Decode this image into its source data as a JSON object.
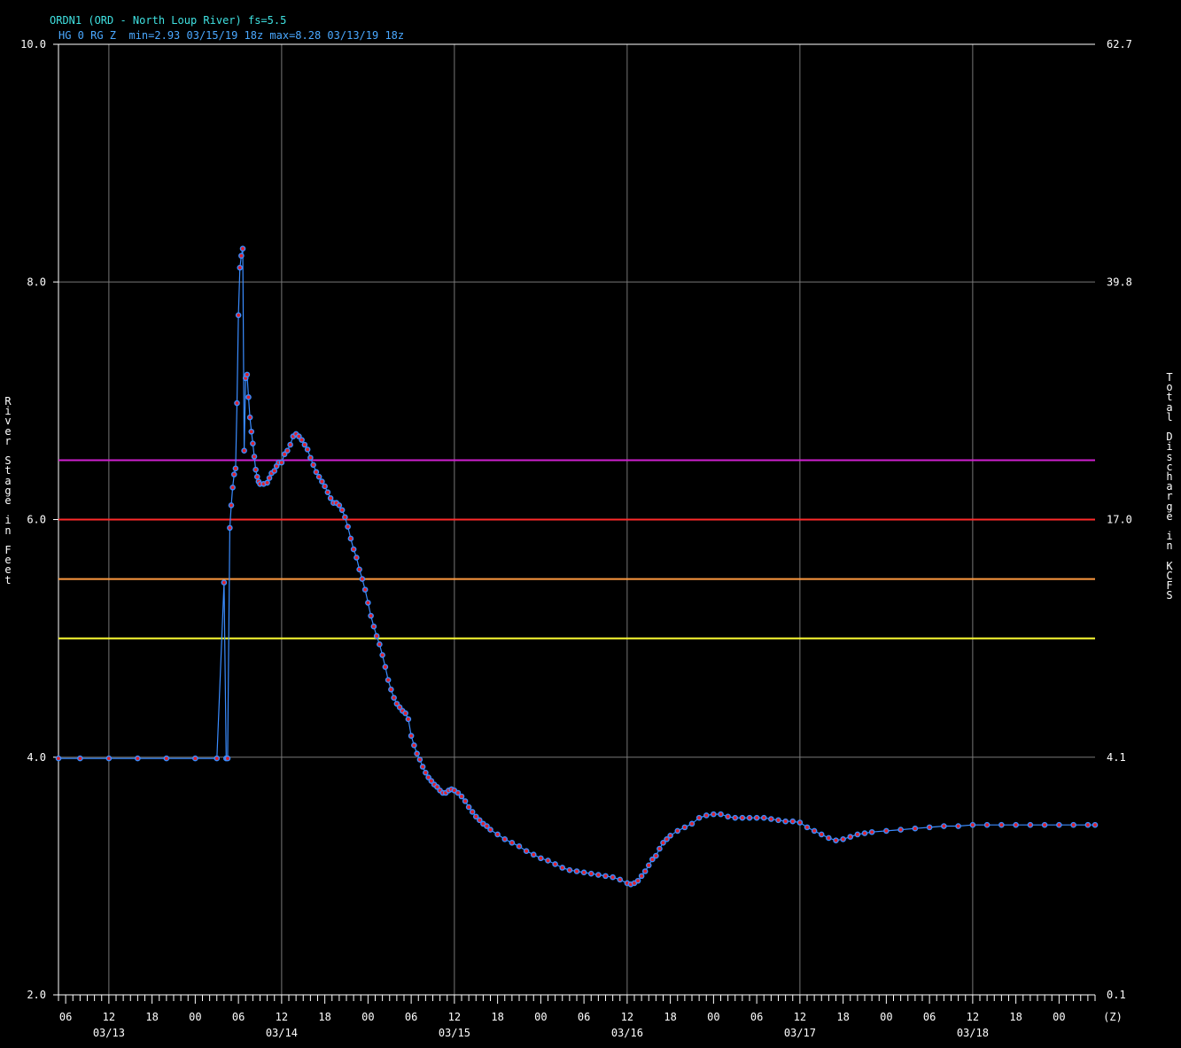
{
  "title_line1": "ORDN1 (ORD - North Loup River) fs=5.5",
  "title_line2": "HG 0 RG Z  min=2.93 03/15/19 18z max=8.28 03/13/19 18z",
  "chart_data": {
    "type": "line",
    "ylabel_left": "River Stage in Feet",
    "ylabel_right": "Total Discharge in KCFS",
    "ylim": [
      2.0,
      10.0
    ],
    "y_ticks_left": [
      "10.0",
      "8.0",
      "6.0",
      "4.0",
      "2.0"
    ],
    "y_ticks_right": [
      "62.7",
      "39.8",
      "17.0",
      "4.1",
      "0.1"
    ],
    "x_hour_ticks": [
      "06",
      "12",
      "18",
      "00",
      "06",
      "12",
      "18",
      "00",
      "06",
      "12",
      "18",
      "00",
      "06",
      "12",
      "18",
      "00",
      "06",
      "12",
      "18",
      "00",
      "06",
      "12",
      "18",
      "00"
    ],
    "x_date_ticks": [
      "03/13",
      "03/14",
      "03/15",
      "03/16",
      "03/17",
      "03/18"
    ],
    "x_unit_label": "(Z)",
    "x_range_hours_from_03_13_00z": [
      -7,
      137
    ],
    "threshold_lines": [
      {
        "stage": 6.5,
        "color": "#d020d0"
      },
      {
        "stage": 6.0,
        "color": "#ff2a2a"
      },
      {
        "stage": 5.5,
        "color": "#ff9a40"
      },
      {
        "stage": 5.0,
        "color": "#ffff33"
      }
    ],
    "series": [
      {
        "line_color": "#3a8cff",
        "marker_color": "#e0202a",
        "points": [
          [
            -7,
            3.99
          ],
          [
            -4,
            3.99
          ],
          [
            0,
            3.99
          ],
          [
            4,
            3.99
          ],
          [
            8,
            3.99
          ],
          [
            12,
            3.99
          ],
          [
            15,
            3.99
          ],
          [
            16,
            5.47
          ],
          [
            16.3,
            3.99
          ],
          [
            16.5,
            3.99
          ],
          [
            16.8,
            5.93
          ],
          [
            17,
            6.12
          ],
          [
            17.2,
            6.27
          ],
          [
            17.4,
            6.38
          ],
          [
            17.6,
            6.43
          ],
          [
            17.8,
            6.98
          ],
          [
            18,
            7.72
          ],
          [
            18.2,
            8.12
          ],
          [
            18.4,
            8.22
          ],
          [
            18.6,
            8.28
          ],
          [
            18.8,
            6.58
          ],
          [
            19,
            7.19
          ],
          [
            19.2,
            7.22
          ],
          [
            19.4,
            7.03
          ],
          [
            19.6,
            6.86
          ],
          [
            19.8,
            6.74
          ],
          [
            20,
            6.64
          ],
          [
            20.2,
            6.53
          ],
          [
            20.4,
            6.42
          ],
          [
            20.6,
            6.36
          ],
          [
            20.8,
            6.32
          ],
          [
            21,
            6.3
          ],
          [
            21.5,
            6.3
          ],
          [
            22,
            6.31
          ],
          [
            22.3,
            6.35
          ],
          [
            22.6,
            6.39
          ],
          [
            23,
            6.41
          ],
          [
            23.3,
            6.45
          ],
          [
            23.6,
            6.48
          ],
          [
            24,
            6.48
          ],
          [
            24.4,
            6.55
          ],
          [
            24.8,
            6.58
          ],
          [
            25.2,
            6.63
          ],
          [
            25.6,
            6.7
          ],
          [
            26,
            6.72
          ],
          [
            26.4,
            6.7
          ],
          [
            26.8,
            6.67
          ],
          [
            27.2,
            6.63
          ],
          [
            27.6,
            6.59
          ],
          [
            28,
            6.52
          ],
          [
            28.4,
            6.46
          ],
          [
            28.8,
            6.4
          ],
          [
            29.2,
            6.36
          ],
          [
            29.6,
            6.32
          ],
          [
            30,
            6.28
          ],
          [
            30.4,
            6.23
          ],
          [
            30.8,
            6.18
          ],
          [
            31.2,
            6.14
          ],
          [
            31.6,
            6.14
          ],
          [
            32,
            6.12
          ],
          [
            32.4,
            6.08
          ],
          [
            32.8,
            6.02
          ],
          [
            33.2,
            5.94
          ],
          [
            33.6,
            5.84
          ],
          [
            34,
            5.75
          ],
          [
            34.4,
            5.68
          ],
          [
            34.8,
            5.58
          ],
          [
            35.2,
            5.5
          ],
          [
            35.6,
            5.41
          ],
          [
            36,
            5.3
          ],
          [
            36.4,
            5.19
          ],
          [
            36.8,
            5.1
          ],
          [
            37.2,
            5.02
          ],
          [
            37.6,
            4.95
          ],
          [
            38,
            4.86
          ],
          [
            38.4,
            4.76
          ],
          [
            38.8,
            4.65
          ],
          [
            39.2,
            4.57
          ],
          [
            39.6,
            4.5
          ],
          [
            40,
            4.45
          ],
          [
            40.4,
            4.42
          ],
          [
            40.8,
            4.39
          ],
          [
            41.2,
            4.37
          ],
          [
            41.6,
            4.32
          ],
          [
            42,
            4.18
          ],
          [
            42.4,
            4.1
          ],
          [
            42.8,
            4.03
          ],
          [
            43.2,
            3.98
          ],
          [
            43.6,
            3.92
          ],
          [
            44,
            3.87
          ],
          [
            44.4,
            3.83
          ],
          [
            44.8,
            3.8
          ],
          [
            45.2,
            3.77
          ],
          [
            45.6,
            3.75
          ],
          [
            46,
            3.72
          ],
          [
            46.4,
            3.7
          ],
          [
            46.8,
            3.7
          ],
          [
            47.2,
            3.72
          ],
          [
            47.6,
            3.73
          ],
          [
            48,
            3.72
          ],
          [
            48.5,
            3.7
          ],
          [
            49,
            3.67
          ],
          [
            49.5,
            3.63
          ],
          [
            50,
            3.58
          ],
          [
            50.5,
            3.54
          ],
          [
            51,
            3.5
          ],
          [
            51.5,
            3.47
          ],
          [
            52,
            3.44
          ],
          [
            52.5,
            3.42
          ],
          [
            53,
            3.39
          ],
          [
            54,
            3.35
          ],
          [
            55,
            3.31
          ],
          [
            56,
            3.28
          ],
          [
            57,
            3.25
          ],
          [
            58,
            3.21
          ],
          [
            59,
            3.18
          ],
          [
            60,
            3.15
          ],
          [
            61,
            3.13
          ],
          [
            62,
            3.1
          ],
          [
            63,
            3.07
          ],
          [
            64,
            3.05
          ],
          [
            65,
            3.04
          ],
          [
            66,
            3.03
          ],
          [
            67,
            3.02
          ],
          [
            68,
            3.01
          ],
          [
            69,
            3.0
          ],
          [
            70,
            2.99
          ],
          [
            71,
            2.97
          ],
          [
            72,
            2.94
          ],
          [
            72.5,
            2.93
          ],
          [
            73,
            2.94
          ],
          [
            73.5,
            2.96
          ],
          [
            74,
            3.0
          ],
          [
            74.5,
            3.04
          ],
          [
            75,
            3.09
          ],
          [
            75.5,
            3.14
          ],
          [
            76,
            3.17
          ],
          [
            76.5,
            3.23
          ],
          [
            77,
            3.28
          ],
          [
            77.5,
            3.31
          ],
          [
            78,
            3.34
          ],
          [
            79,
            3.38
          ],
          [
            80,
            3.41
          ],
          [
            81,
            3.44
          ],
          [
            82,
            3.49
          ],
          [
            83,
            3.51
          ],
          [
            84,
            3.52
          ],
          [
            85,
            3.52
          ],
          [
            86,
            3.5
          ],
          [
            87,
            3.49
          ],
          [
            88,
            3.49
          ],
          [
            89,
            3.49
          ],
          [
            90,
            3.49
          ],
          [
            91,
            3.49
          ],
          [
            92,
            3.48
          ],
          [
            93,
            3.47
          ],
          [
            94,
            3.46
          ],
          [
            95,
            3.46
          ],
          [
            96,
            3.45
          ],
          [
            97,
            3.41
          ],
          [
            98,
            3.38
          ],
          [
            99,
            3.35
          ],
          [
            100,
            3.32
          ],
          [
            101,
            3.3
          ],
          [
            102,
            3.31
          ],
          [
            103,
            3.33
          ],
          [
            104,
            3.35
          ],
          [
            105,
            3.36
          ],
          [
            106,
            3.37
          ],
          [
            108,
            3.38
          ],
          [
            110,
            3.39
          ],
          [
            112,
            3.4
          ],
          [
            114,
            3.41
          ],
          [
            116,
            3.42
          ],
          [
            118,
            3.42
          ],
          [
            120,
            3.43
          ],
          [
            122,
            3.43
          ],
          [
            124,
            3.43
          ],
          [
            126,
            3.43
          ],
          [
            128,
            3.43
          ],
          [
            130,
            3.43
          ],
          [
            132,
            3.43
          ],
          [
            134,
            3.43
          ],
          [
            136,
            3.43
          ],
          [
            137,
            3.43
          ]
        ]
      }
    ]
  }
}
